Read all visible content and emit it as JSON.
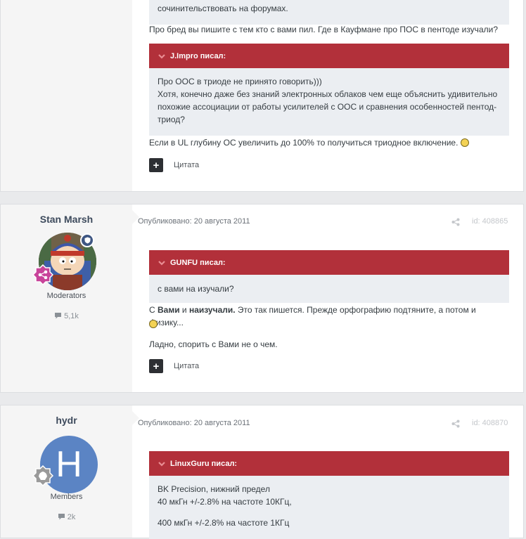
{
  "post1": {
    "quote_tail": "сочинительствовать на форумах.",
    "reply_line": "Про бред вы пишите с тем кто с вами пил. Где в Кауфмане про ПОС в пентоде изучали?",
    "quote_author": "J.Impro писал:",
    "quote_lines": [
      "Про ООС в триоде не принято говорить)))",
      "Хотя, конечно даже без знаний электронных облаков чем еще объяснить удивительно",
      "похожие ассоциации от работы усилителей с ООС и сравнения особенностей пентод-",
      "триод?"
    ],
    "after_quote": "Если в UL глубину ОС увеличить до 100% то получиться триодное включение.",
    "plus_label": "+",
    "cite_label": "Цитата"
  },
  "post2": {
    "author": "Stan Marsh",
    "group": "Moderators",
    "reputation": "5,1k",
    "published": "Опубликовано: 20 августа 2011",
    "post_id": "id: 408865",
    "quote_author": "GUNFU писал:",
    "quote_text": "с вами на изучали?",
    "reply_prefix": "С ",
    "reply_bold1": "Вами",
    "reply_mid": " и ",
    "reply_bold2": "наизучали.",
    "reply_suffix": " Это так пишется. Прежде орфографию подтяните, а потом и физику...",
    "second_line": "Ладно, спорить с Вами не о чем.",
    "plus_label": "+",
    "cite_label": "Цитата"
  },
  "post3": {
    "author": "hydr",
    "avatar_letter": "H",
    "group": "Members",
    "reputation": "2k",
    "published": "Опубликовано: 20 августа 2011",
    "post_id": "id: 408870",
    "quote_author": "LinuxGuru писал:",
    "quote_lines": [
      "BK Precision, нижний предел",
      "40 мкГн +/-2.8% на частоте 10КГц,",
      "",
      "400 мкГн +/-2.8% на частоте 1КГц"
    ]
  },
  "colors": {
    "quote_header": "#b2303a",
    "quote_bg": "#ebeef2",
    "sidebar_bg": "#f5f5f5",
    "page_bg": "#e9eaec",
    "avatar_h": "#5b84c4",
    "badge_pink": "#c8449a"
  },
  "icons": [
    "chevron-down-icon",
    "share-icon",
    "comment-icon",
    "smiley-icon",
    "shield-icon",
    "plus-icon"
  ]
}
